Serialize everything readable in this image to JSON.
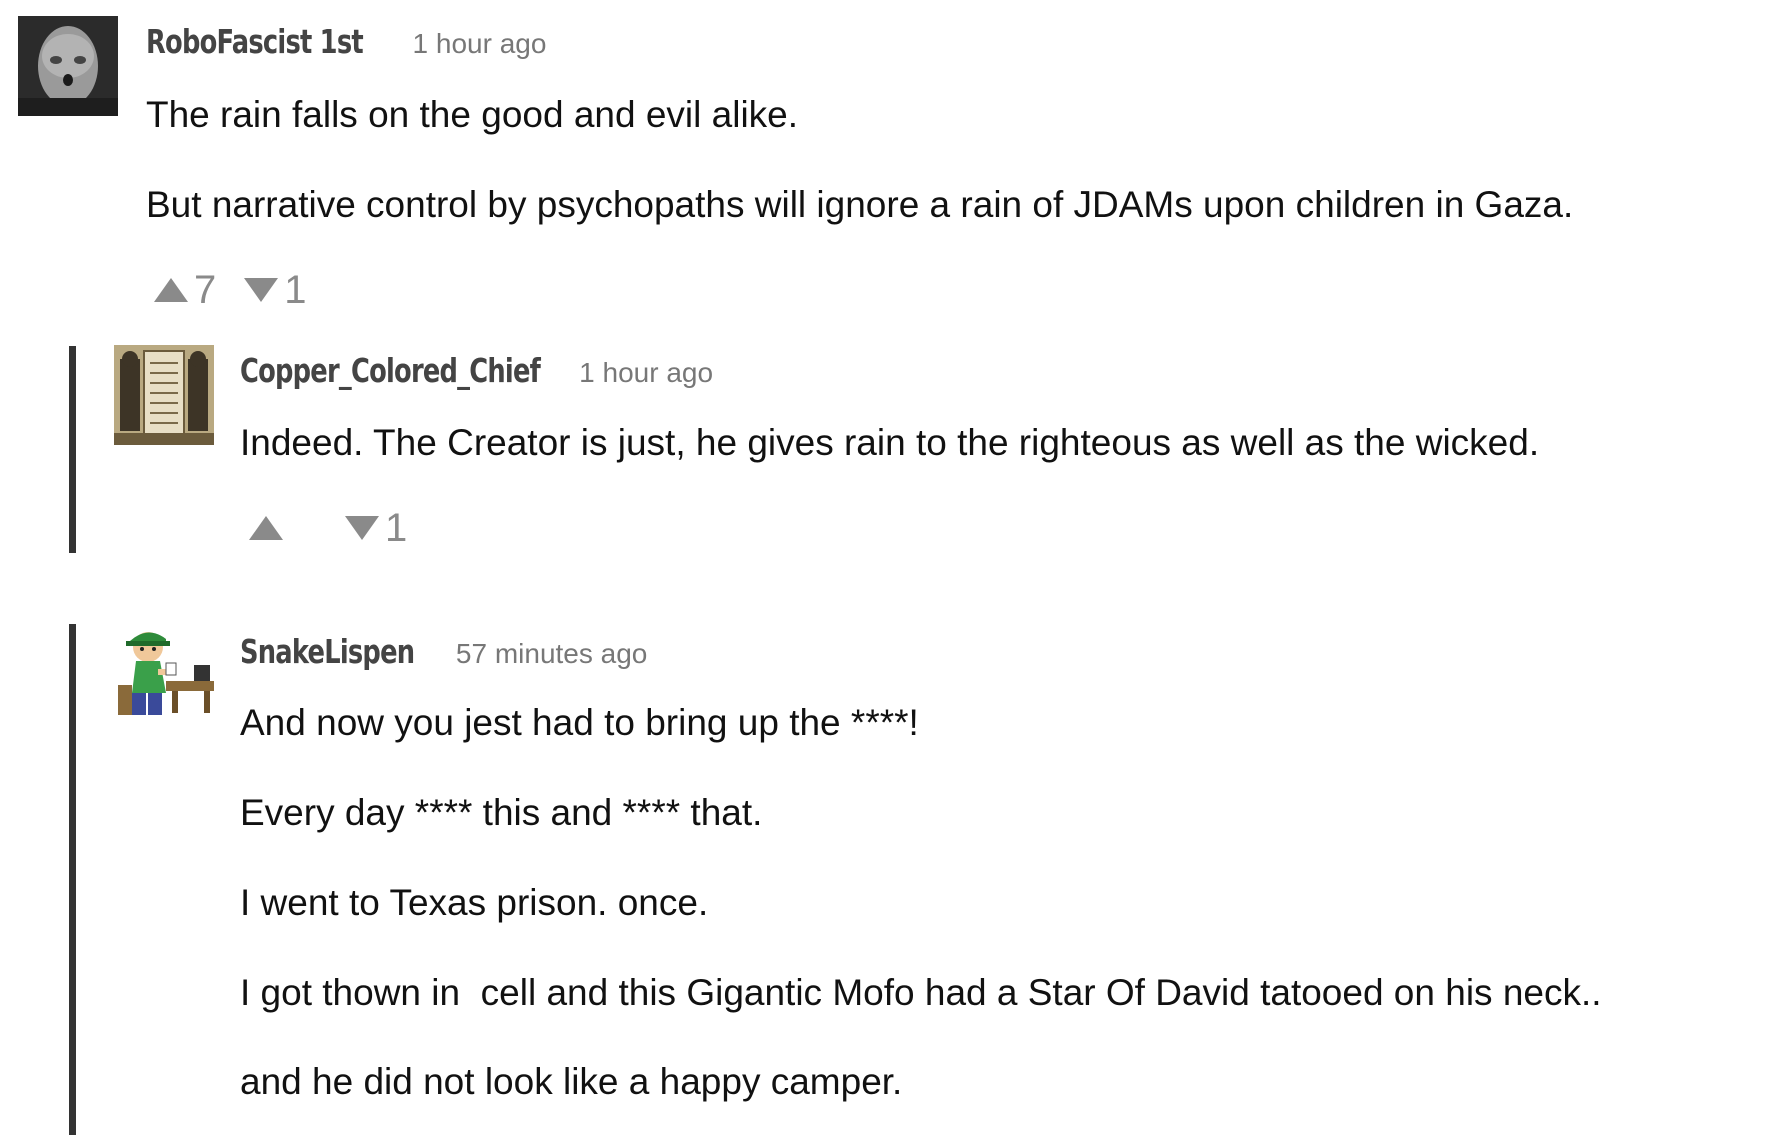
{
  "comments": [
    {
      "username": "RoboFascist 1st",
      "timestamp": "1 hour ago",
      "paragraphs": [
        "The rain falls on the good and evil alike.",
        "But narrative control by psychopaths will ignore a rain of JDAMs upon children in Gaza."
      ],
      "upvotes": "7",
      "downvotes": "1",
      "avatar_icon": "grey-face-avatar"
    },
    {
      "username": "Copper_Colored_Chief",
      "timestamp": "1 hour ago",
      "paragraphs": [
        "Indeed. The Creator is just, he gives rain to the righteous as well as the wicked."
      ],
      "upvotes": "",
      "downvotes": "1",
      "avatar_icon": "parchment-statues-avatar"
    },
    {
      "username": "SnakeLispen",
      "timestamp": "57 minutes ago",
      "paragraphs": [
        "And now you jest had to bring up the ****!",
        "Every day **** this and **** that.",
        "I went to Texas prison. once.",
        "I got thown in  cell and this Gigantic Mofo had a Star Of David tatooed on his neck..",
        "and he did not look like a happy camper."
      ],
      "avatar_icon": "cartoon-man-at-desk-avatar"
    }
  ],
  "colors": {
    "thread_bar": "#333333",
    "vote_icon": "#8a8a8a",
    "username": "#444444",
    "timestamp": "#777777"
  }
}
